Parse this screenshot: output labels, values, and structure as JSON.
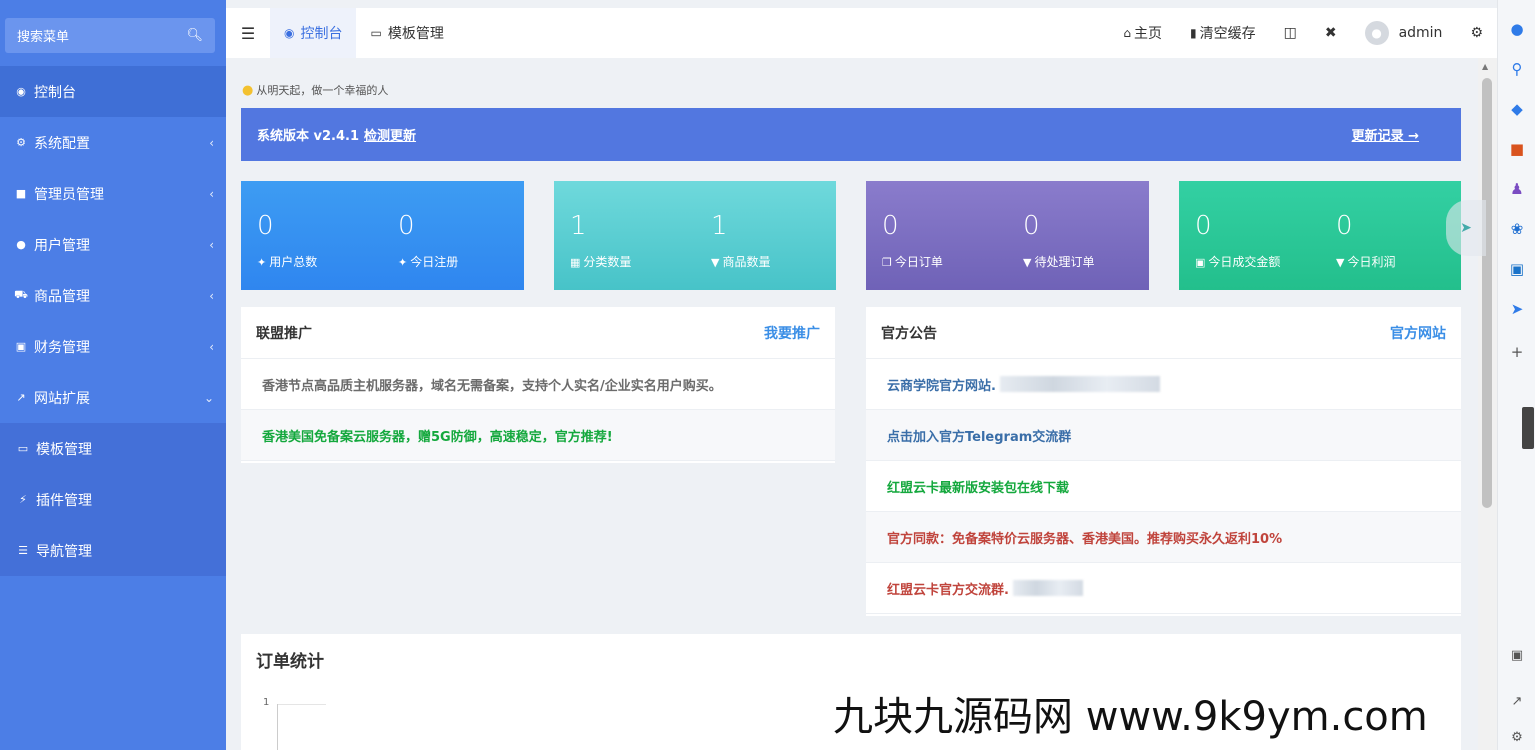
{
  "sidebar": {
    "search_placeholder": "搜索菜单",
    "items": [
      {
        "label": "控制台",
        "icon": "dashboard-icon",
        "glyph": "◉"
      },
      {
        "label": "系统配置",
        "icon": "cogs-icon",
        "glyph": "⚙",
        "arrow": "‹"
      },
      {
        "label": "管理员管理",
        "icon": "windows-icon",
        "glyph": "■",
        "arrow": "‹"
      },
      {
        "label": "用户管理",
        "icon": "user-icon",
        "glyph": "●",
        "arrow": "‹"
      },
      {
        "label": "商品管理",
        "icon": "cart-icon",
        "glyph": "⛟",
        "arrow": "‹"
      },
      {
        "label": "财务管理",
        "icon": "book-icon",
        "glyph": "▣",
        "arrow": "‹"
      },
      {
        "label": "网站扩展",
        "icon": "external-icon",
        "glyph": "↗",
        "arrow": "⌄"
      }
    ],
    "sub_items": [
      {
        "label": "模板管理",
        "icon": "monitor-icon",
        "glyph": "▭"
      },
      {
        "label": "插件管理",
        "icon": "plug-icon",
        "glyph": "⚡"
      },
      {
        "label": "导航管理",
        "icon": "sliders-icon",
        "glyph": "☰"
      }
    ]
  },
  "topbar": {
    "tabs": [
      {
        "label": "控制台",
        "glyph": "◉"
      },
      {
        "label": "模板管理",
        "glyph": "▭"
      }
    ],
    "home_label": "主页",
    "clear_cache_label": "清空缓存",
    "user_name": "admin"
  },
  "main": {
    "tip": "从明天起，做一个幸福的人",
    "version_text": "系统版本 v2.4.1",
    "check_update": "检测更新",
    "changelog": "更新记录 →",
    "stats": [
      {
        "a_num": "0",
        "a_label": "用户总数",
        "b_num": "0",
        "b_label": "今日注册"
      },
      {
        "a_num": "1",
        "a_label": "分类数量",
        "b_num": "1",
        "b_label": "商品数量"
      },
      {
        "a_num": "0",
        "a_label": "今日订单",
        "b_num": "0",
        "b_label": "待处理订单"
      },
      {
        "a_num": "0",
        "a_label": "今日成交金额",
        "b_num": "0",
        "b_label": "今日利润"
      }
    ],
    "alliance": {
      "title": "联盟推广",
      "link": "我要推广",
      "rows": [
        "香港节点高品质主机服务器，域名无需备案，支持个人实名/企业实名用户购买。",
        "香港美国免备案云服务器，赠5G防御，高速稳定，官方推荐!"
      ]
    },
    "notice": {
      "title": "官方公告",
      "link": "官方网站",
      "rows": [
        "云商学院官方网站.",
        "点击加入官方Telegram交流群",
        "红盟云卡最新版安装包在线下载",
        "官方同款：免备案特价云服务器、香港美国。推荐购买永久返利10%",
        "红盟云卡官方交流群."
      ]
    },
    "order_stats": {
      "title": "订单统计",
      "y_tick": "1"
    }
  },
  "watermark": "九块九源码网 www.9k9ym.com",
  "colors": {
    "sidebar": "#4c7ee6",
    "accent": "#3a6fe0",
    "green": "#14a83d",
    "red": "#c0443c"
  }
}
